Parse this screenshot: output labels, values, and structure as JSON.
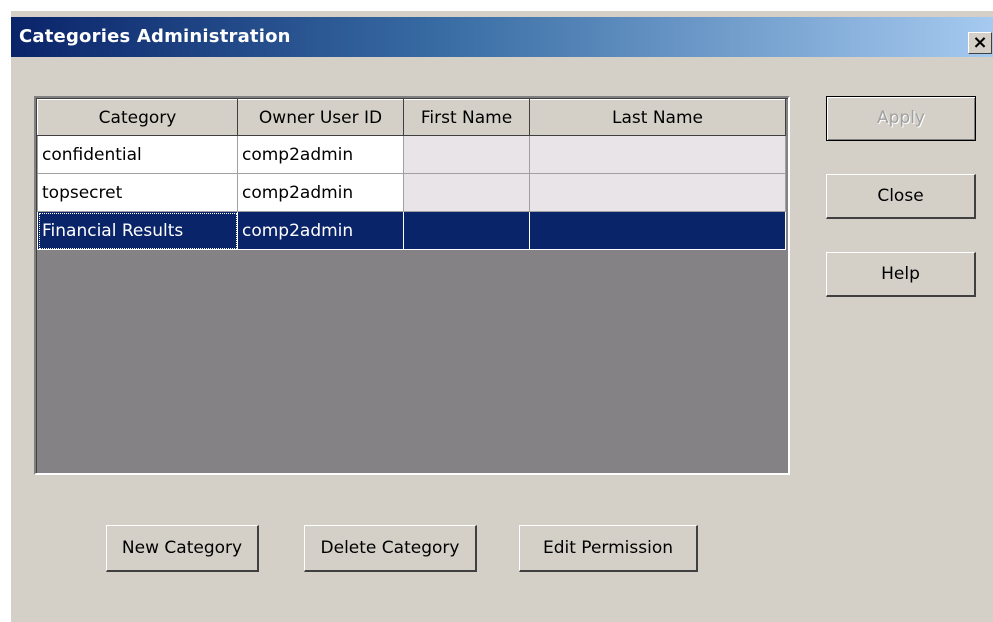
{
  "window": {
    "title": "Categories Administration",
    "close_glyph": "×"
  },
  "table": {
    "columns": [
      "Category",
      "Owner User ID",
      "First Name",
      "Last Name"
    ],
    "rows": [
      {
        "category": "confidential",
        "owner": "comp2admin",
        "first_name": "",
        "last_name": ""
      },
      {
        "category": "topsecret",
        "owner": "comp2admin",
        "first_name": "",
        "last_name": ""
      },
      {
        "category": "Financial Results",
        "owner": "comp2admin",
        "first_name": "",
        "last_name": ""
      }
    ],
    "selected_row_index": 2
  },
  "side_buttons": {
    "apply": "Apply",
    "close": "Close",
    "help": "Help"
  },
  "bottom_buttons": {
    "new_category": "New Category",
    "delete_category": "Delete Category",
    "edit_permission": "Edit Permission"
  },
  "colors": {
    "title_gradient_start": "#0a246a",
    "title_gradient_end": "#a6caf0",
    "selection": "#0a246a",
    "dialog_face": "#d4d0c8",
    "grid_empty": "#848284"
  }
}
